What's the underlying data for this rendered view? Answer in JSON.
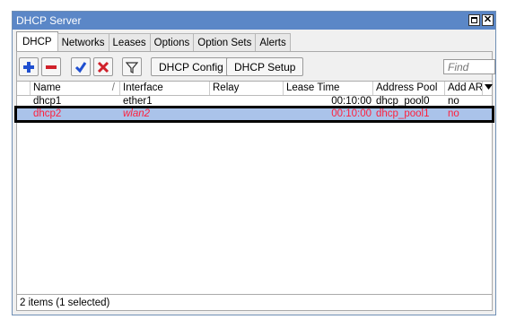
{
  "window": {
    "title": "DHCP Server"
  },
  "tabs": [
    "DHCP",
    "Networks",
    "Leases",
    "Options",
    "Option Sets",
    "Alerts"
  ],
  "toolbar": {
    "add_icon": "plus-icon",
    "remove_icon": "minus-icon",
    "enable_icon": "check-icon",
    "disable_icon": "x-icon",
    "filter_icon": "funnel-icon",
    "dhcp_config_label": "DHCP Config",
    "dhcp_setup_label": "DHCP Setup",
    "find_placeholder": "Find"
  },
  "table": {
    "columns": [
      "Name",
      "Interface",
      "Relay",
      "Lease Time",
      "Address Pool",
      "Add AR"
    ],
    "sort_indicator": "/",
    "rows": [
      {
        "name": "dhcp1",
        "interface": "ether1",
        "relay": "",
        "lease_time": "00:10:00",
        "address_pool": "dhcp_pool0",
        "add_arp": "no",
        "selected": false
      },
      {
        "name": "dhcp2",
        "interface": "wlan2",
        "relay": "",
        "lease_time": "00:10:00",
        "address_pool": "dhcp_pool1",
        "add_arp": "no",
        "selected": true
      }
    ]
  },
  "status": {
    "text": "2 items (1 selected)"
  },
  "colors": {
    "titlebar": "#5b87c7",
    "selected_row": "#aac3ea",
    "selected_text": "#ff1f3c"
  }
}
